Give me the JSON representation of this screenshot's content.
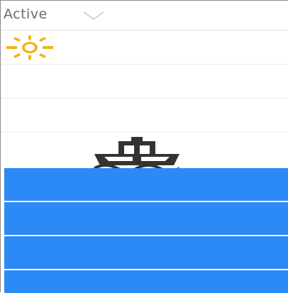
{
  "dropdown": {
    "selected_label": "Active",
    "chevron_icon": "chevron-down-icon"
  },
  "list": {
    "rows": [
      {
        "icon": "sun-icon",
        "icon_color": "#f5b21a"
      },
      {
        "icon": ""
      },
      {
        "icon": ""
      },
      {
        "icon": "ship-icon",
        "icon_color": "#333333"
      }
    ],
    "selected_rows_color": "#2b8af6",
    "selected_rows_count": 4
  }
}
